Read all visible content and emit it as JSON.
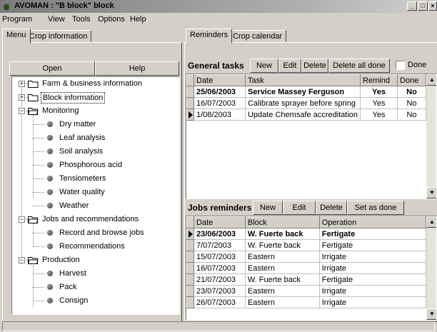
{
  "window": {
    "title": "AVOMAN : \"B block\" block"
  },
  "menubar": [
    "Program",
    "View",
    "Tools",
    "Options",
    "Help"
  ],
  "left_tabs": [
    "Menu",
    "Crop information"
  ],
  "left_buttons": {
    "open": "Open",
    "help": "Help"
  },
  "tree": [
    {
      "label": "Farm & business information",
      "level": 0,
      "type": "folder",
      "expander": "+"
    },
    {
      "label": "Block information",
      "level": 0,
      "type": "folder",
      "expander": "+",
      "selected": true
    },
    {
      "label": "Monitoring",
      "level": 0,
      "type": "folder-open",
      "expander": "−"
    },
    {
      "label": "Dry matter",
      "level": 1,
      "type": "item"
    },
    {
      "label": "Leaf analysis",
      "level": 1,
      "type": "item"
    },
    {
      "label": "Soil analysis",
      "level": 1,
      "type": "item"
    },
    {
      "label": "Phosphorous acid",
      "level": 1,
      "type": "item"
    },
    {
      "label": "Tensiometers",
      "level": 1,
      "type": "item"
    },
    {
      "label": "Water quality",
      "level": 1,
      "type": "item"
    },
    {
      "label": "Weather",
      "level": 1,
      "type": "item"
    },
    {
      "label": "Jobs and recommendations",
      "level": 0,
      "type": "folder-open",
      "expander": "−"
    },
    {
      "label": "Record and browse jobs",
      "level": 1,
      "type": "item"
    },
    {
      "label": "Recommendations",
      "level": 1,
      "type": "item"
    },
    {
      "label": "Production",
      "level": 0,
      "type": "folder-open",
      "expander": "−"
    },
    {
      "label": "Harvest",
      "level": 1,
      "type": "item"
    },
    {
      "label": "Pack",
      "level": 1,
      "type": "item"
    },
    {
      "label": "Consign",
      "level": 1,
      "type": "item"
    }
  ],
  "right_tabs": [
    "Reminders",
    "Crop calendar"
  ],
  "general_tasks": {
    "title": "General tasks",
    "buttons": [
      "New",
      "Edit",
      "Delete",
      "Delete all done"
    ],
    "done_checkbox_label": "Done",
    "columns": [
      "Date",
      "Task",
      "Remind",
      "Done"
    ],
    "rows": [
      {
        "date": "25/06/2003",
        "task": "Service Massey Ferguson",
        "remind": "Yes",
        "done": "No",
        "bold": true
      },
      {
        "date": "16/07/2003",
        "task": "Calibrate sprayer before spring",
        "remind": "Yes",
        "done": "No"
      },
      {
        "date": "1/08/2003",
        "task": "Update Chemsafe accreditation",
        "remind": "Yes",
        "done": "No",
        "current": true
      }
    ]
  },
  "jobs_reminders": {
    "title": "Jobs reminders",
    "buttons": [
      "New",
      "Edit",
      "Delete",
      "Set as done"
    ],
    "columns": [
      "Date",
      "Block",
      "Operation"
    ],
    "rows": [
      {
        "date": "23/06/2003",
        "block": "W. Fuerte back",
        "operation": "Fertigate",
        "bold": true,
        "current": true
      },
      {
        "date": "7/07/2003",
        "block": "W. Fuerte back",
        "operation": "Fertigate"
      },
      {
        "date": "15/07/2003",
        "block": "Eastern",
        "operation": "Irrigate"
      },
      {
        "date": "16/07/2003",
        "block": "Eastern",
        "operation": "Irrigate"
      },
      {
        "date": "21/07/2003",
        "block": "W. Fuerte back",
        "operation": "Fertigate"
      },
      {
        "date": "23/07/2003",
        "block": "Eastern",
        "operation": "Irrigate"
      },
      {
        "date": "26/07/2003",
        "block": "Eastern",
        "operation": "Irrigate"
      }
    ]
  }
}
